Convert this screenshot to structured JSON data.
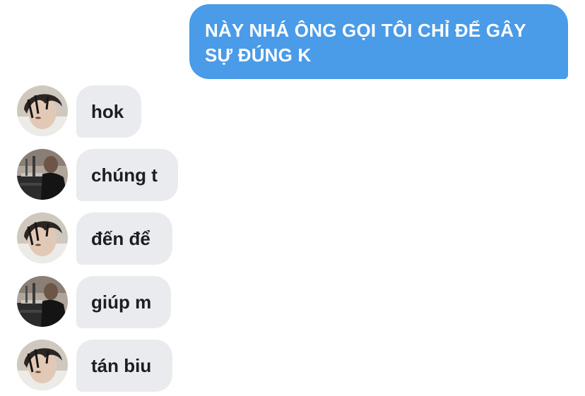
{
  "conversation": {
    "outgoing": {
      "line1": "NÀY NHÁ ÔNG GỌI TÔI CHỈ ĐỂ GÂY",
      "line2": "SỰ ĐÚNG K"
    },
    "incoming": [
      {
        "text": "hok",
        "avatar": "avatar-a"
      },
      {
        "text": "chúng t",
        "avatar": "avatar-b"
      },
      {
        "text": "đến để",
        "avatar": "avatar-a"
      },
      {
        "text": "giúp m",
        "avatar": "avatar-b"
      },
      {
        "text": "tán biu",
        "avatar": "avatar-a"
      }
    ]
  },
  "colors": {
    "outgoing_bubble": "#4a9be8",
    "incoming_bubble": "#e9ebee",
    "incoming_text": "#1c1e21"
  }
}
